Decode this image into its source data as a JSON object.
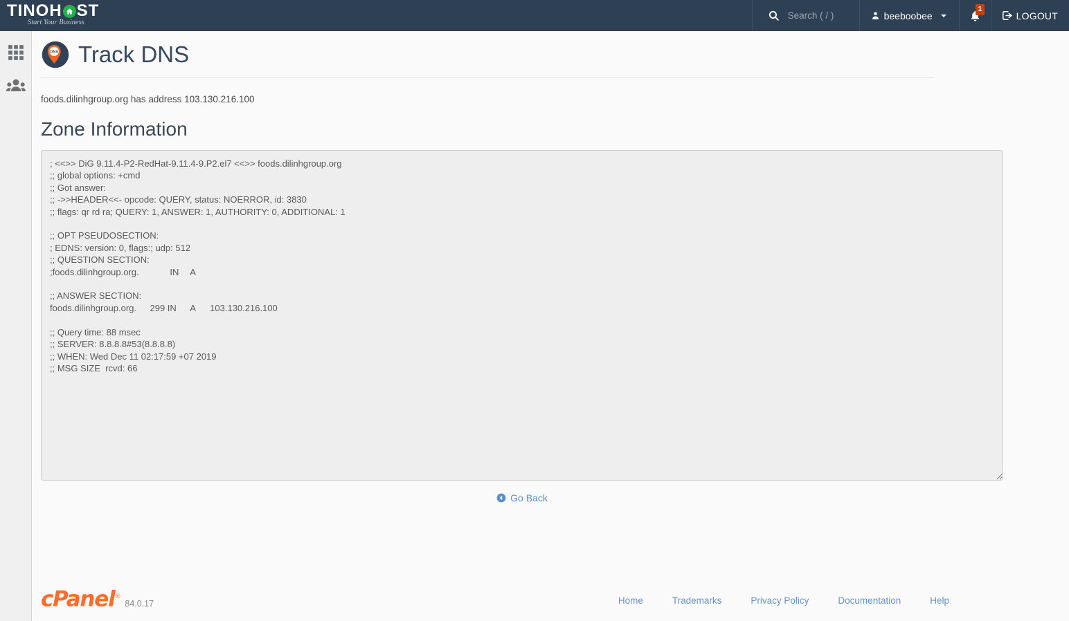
{
  "header": {
    "brand": {
      "text_left": "TINOH",
      "text_right": "ST",
      "icon": "house-icon",
      "tagline": "Start Your Business"
    },
    "search": {
      "placeholder": "Search ( / )",
      "value": "",
      "icon": "search-icon"
    },
    "user": {
      "name": "beeboobee",
      "icon": "user-icon",
      "caret": "chevron-down-icon"
    },
    "notifications": {
      "icon": "bell-icon",
      "count": "1",
      "badge_color": "#c34113"
    },
    "logout": {
      "label": "LOGOUT",
      "icon": "logout-icon"
    },
    "background_color": "#2e4154"
  },
  "sidebar": {
    "items": [
      {
        "name": "apps-grid-icon",
        "label": "Apps"
      },
      {
        "name": "users-group-icon",
        "label": "User Manager"
      }
    ],
    "background_color": "#f0f0f0"
  },
  "page": {
    "title": "Track DNS",
    "icon": "dns-pin-icon",
    "icon_label": "DNS",
    "address_line": "foods.dilinhgroup.org has address 103.130.216.100",
    "section_title": "Zone Information",
    "title_color": "#36495e"
  },
  "zone_output": {
    "text": "; <<>> DiG 9.11.4-P2-RedHat-9.11.4-9.P2.el7 <<>> foods.dilinhgroup.org\n;; global options: +cmd\n;; Got answer:\n;; ->>HEADER<<- opcode: QUERY, status: NOERROR, id: 3830\n;; flags: qr rd ra; QUERY: 1, ANSWER: 1, AUTHORITY: 0, ADDITIONAL: 1\n\n;; OPT PSEUDOSECTION:\n; EDNS: version: 0, flags:; udp: 512\n;; QUESTION SECTION:\n;foods.dilinhgroup.org.\t\tIN\tA\n\n;; ANSWER SECTION:\nfoods.dilinhgroup.org.\t299 IN\tA\t103.130.216.100\n\n;; Query time: 88 msec\n;; SERVER: 8.8.8.8#53(8.8.8.8)\n;; WHEN: Wed Dec 11 02:17:59 +07 2019\n;; MSG SIZE  rcvd: 66\n",
    "background_color": "#eeeeee"
  },
  "actions": {
    "go_back": {
      "label": "Go Back",
      "icon": "arrow-left-circle-icon",
      "color": "#5a8fcc"
    }
  },
  "footer": {
    "logo_text": "cPanel",
    "registered_mark": "®",
    "version": "84.0.17",
    "links": [
      {
        "label": "Home"
      },
      {
        "label": "Trademarks"
      },
      {
        "label": "Privacy Policy"
      },
      {
        "label": "Documentation"
      },
      {
        "label": "Help"
      }
    ],
    "logo_color": "#ff6c2c"
  }
}
